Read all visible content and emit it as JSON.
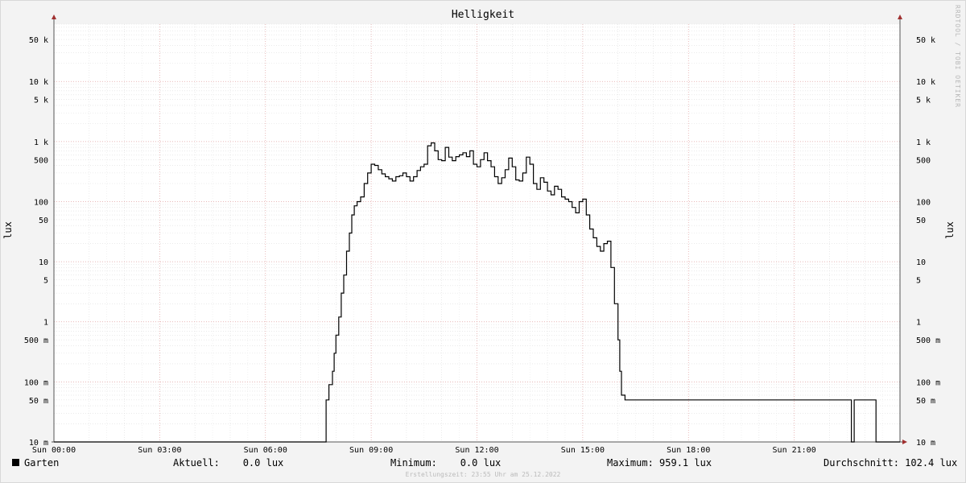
{
  "chart_data": {
    "type": "line",
    "title": "Helligkeit",
    "ylabel": "lux",
    "yscale": "log",
    "ylim": [
      0.01,
      90000
    ],
    "xlim": [
      0,
      24
    ],
    "watermark": "RRDTOOL / TOBI OETIKER",
    "y_ticks": [
      {
        "v": 0.01,
        "label": "10 m"
      },
      {
        "v": 0.05,
        "label": "50 m"
      },
      {
        "v": 0.1,
        "label": "100 m"
      },
      {
        "v": 0.5,
        "label": "500 m"
      },
      {
        "v": 1,
        "label": "1"
      },
      {
        "v": 5,
        "label": "5"
      },
      {
        "v": 10,
        "label": "10"
      },
      {
        "v": 50,
        "label": "50"
      },
      {
        "v": 100,
        "label": "100"
      },
      {
        "v": 500,
        "label": "500"
      },
      {
        "v": 1000,
        "label": "1 k"
      },
      {
        "v": 5000,
        "label": "5 k"
      },
      {
        "v": 10000,
        "label": "10 k"
      },
      {
        "v": 50000,
        "label": "50 k"
      }
    ],
    "x_ticks": [
      {
        "v": 0,
        "label": "Sun 00:00"
      },
      {
        "v": 3,
        "label": "Sun 03:00"
      },
      {
        "v": 6,
        "label": "Sun 06:00"
      },
      {
        "v": 9,
        "label": "Sun 09:00"
      },
      {
        "v": 12,
        "label": "Sun 12:00"
      },
      {
        "v": 15,
        "label": "Sun 15:00"
      },
      {
        "v": 18,
        "label": "Sun 18:00"
      },
      {
        "v": 21,
        "label": "Sun 21:00"
      }
    ],
    "series": [
      {
        "name": "Garten",
        "color": "#000000",
        "points": [
          [
            0,
            0.01
          ],
          [
            7.7,
            0.01
          ],
          [
            7.72,
            0.05
          ],
          [
            7.8,
            0.09
          ],
          [
            7.9,
            0.15
          ],
          [
            7.95,
            0.3
          ],
          [
            8.0,
            0.6
          ],
          [
            8.08,
            1.2
          ],
          [
            8.15,
            3
          ],
          [
            8.22,
            6
          ],
          [
            8.3,
            15
          ],
          [
            8.38,
            30
          ],
          [
            8.45,
            60
          ],
          [
            8.52,
            85
          ],
          [
            8.6,
            100
          ],
          [
            8.7,
            120
          ],
          [
            8.8,
            200
          ],
          [
            8.9,
            300
          ],
          [
            9.0,
            420
          ],
          [
            9.1,
            400
          ],
          [
            9.2,
            340
          ],
          [
            9.3,
            290
          ],
          [
            9.4,
            260
          ],
          [
            9.5,
            240
          ],
          [
            9.6,
            220
          ],
          [
            9.7,
            260
          ],
          [
            9.8,
            270
          ],
          [
            9.9,
            300
          ],
          [
            10.0,
            260
          ],
          [
            10.1,
            220
          ],
          [
            10.2,
            260
          ],
          [
            10.3,
            330
          ],
          [
            10.4,
            380
          ],
          [
            10.5,
            420
          ],
          [
            10.6,
            850
          ],
          [
            10.7,
            950
          ],
          [
            10.8,
            700
          ],
          [
            10.9,
            500
          ],
          [
            11.0,
            480
          ],
          [
            11.1,
            800
          ],
          [
            11.2,
            550
          ],
          [
            11.3,
            480
          ],
          [
            11.4,
            560
          ],
          [
            11.5,
            600
          ],
          [
            11.6,
            650
          ],
          [
            11.7,
            560
          ],
          [
            11.8,
            700
          ],
          [
            11.9,
            420
          ],
          [
            12.0,
            380
          ],
          [
            12.1,
            500
          ],
          [
            12.2,
            650
          ],
          [
            12.3,
            480
          ],
          [
            12.4,
            380
          ],
          [
            12.5,
            260
          ],
          [
            12.6,
            200
          ],
          [
            12.7,
            250
          ],
          [
            12.8,
            340
          ],
          [
            12.9,
            530
          ],
          [
            13.0,
            380
          ],
          [
            13.1,
            230
          ],
          [
            13.2,
            220
          ],
          [
            13.3,
            300
          ],
          [
            13.4,
            550
          ],
          [
            13.5,
            420
          ],
          [
            13.6,
            200
          ],
          [
            13.7,
            160
          ],
          [
            13.8,
            250
          ],
          [
            13.9,
            210
          ],
          [
            14.0,
            150
          ],
          [
            14.1,
            130
          ],
          [
            14.2,
            180
          ],
          [
            14.3,
            160
          ],
          [
            14.4,
            120
          ],
          [
            14.5,
            110
          ],
          [
            14.6,
            100
          ],
          [
            14.7,
            80
          ],
          [
            14.8,
            65
          ],
          [
            14.9,
            100
          ],
          [
            15.0,
            110
          ],
          [
            15.1,
            60
          ],
          [
            15.2,
            35
          ],
          [
            15.3,
            25
          ],
          [
            15.4,
            18
          ],
          [
            15.5,
            15
          ],
          [
            15.6,
            20
          ],
          [
            15.7,
            22
          ],
          [
            15.8,
            8
          ],
          [
            15.9,
            2
          ],
          [
            16.0,
            0.5
          ],
          [
            16.05,
            0.15
          ],
          [
            16.1,
            0.06
          ],
          [
            16.2,
            0.05
          ],
          [
            22.6,
            0.05
          ],
          [
            22.62,
            0.01
          ],
          [
            22.7,
            0.05
          ],
          [
            23.3,
            0.05
          ],
          [
            23.32,
            0.01
          ],
          [
            24,
            0.01
          ]
        ]
      }
    ]
  },
  "legend": {
    "series_name": "Garten",
    "current": "Aktuell:    0.0 lux",
    "minimum": "Minimum:    0.0 lux",
    "maximum": "Maximum: 959.1 lux",
    "average": "Durchschnitt: 102.4 lux"
  },
  "footer": "Erstellungszeit: 23:55 Uhr am 25.12.2022"
}
